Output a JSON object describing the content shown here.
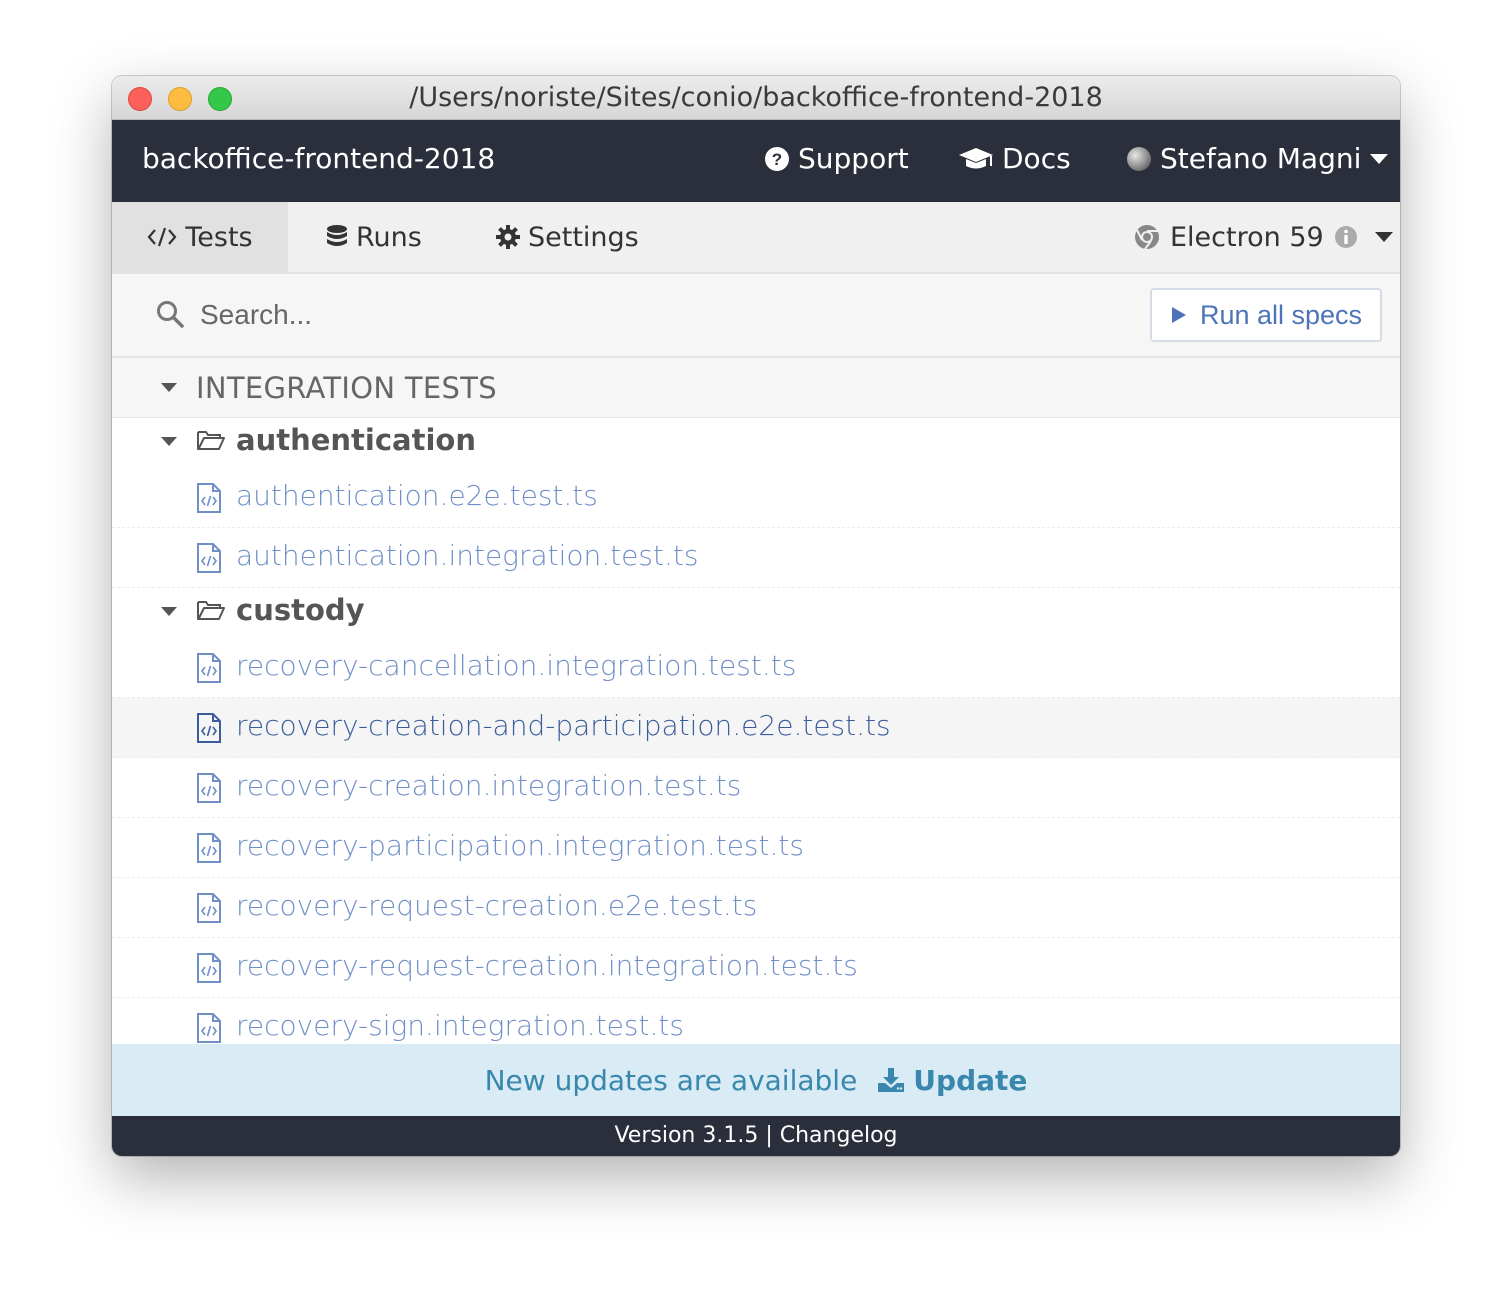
{
  "window": {
    "title": "/Users/noriste/Sites/conio/backoffice-frontend-2018"
  },
  "header": {
    "project_name": "backoffice-frontend-2018",
    "support_label": "Support",
    "docs_label": "Docs",
    "user_name": "Stefano Magni"
  },
  "nav": {
    "tabs": [
      {
        "label": "Tests",
        "icon": "code-icon",
        "active": true
      },
      {
        "label": "Runs",
        "icon": "database-icon",
        "active": false
      },
      {
        "label": "Settings",
        "icon": "gear-icon",
        "active": false
      }
    ],
    "browser": {
      "label": "Electron 59",
      "icon": "chrome-icon"
    }
  },
  "search": {
    "placeholder": "Search...",
    "value": ""
  },
  "run_all_label": "Run all specs",
  "specs": {
    "section_title": "INTEGRATION TESTS",
    "folders": [
      {
        "name": "authentication",
        "files": [
          {
            "name": "authentication.e2e.test.ts"
          },
          {
            "name": "authentication.integration.test.ts"
          }
        ]
      },
      {
        "name": "custody",
        "files": [
          {
            "name": "recovery-cancellation.integration.test.ts"
          },
          {
            "name": "recovery-creation-and-participation.e2e.test.ts",
            "selected": true
          },
          {
            "name": "recovery-creation.integration.test.ts"
          },
          {
            "name": "recovery-participation.integration.test.ts"
          },
          {
            "name": "recovery-request-creation.e2e.test.ts"
          },
          {
            "name": "recovery-request-creation.integration.test.ts"
          },
          {
            "name": "recovery-sign.integration.test.ts"
          }
        ]
      }
    ]
  },
  "update_banner": {
    "message": "New updates are available",
    "link_label": "Update"
  },
  "footer": {
    "version": "Version 3.1.5",
    "separator": "|",
    "changelog": "Changelog"
  },
  "colors": {
    "header_bg": "#2b2e3b",
    "spec_link": "#6f8fc6",
    "banner_bg": "#d9ebf5",
    "banner_text": "#3a87ad"
  }
}
